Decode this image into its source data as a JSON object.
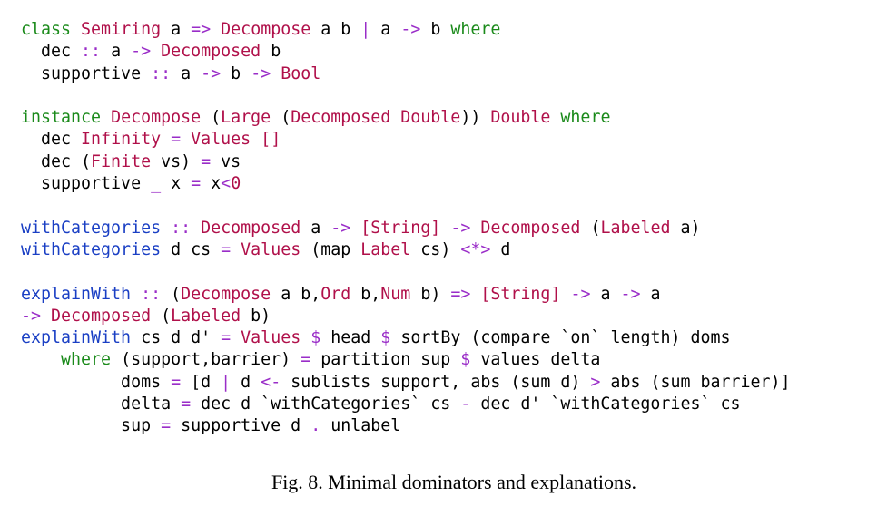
{
  "colors": {
    "keyword": "#1a8a1a",
    "type": "#b0104a",
    "function": "#1a3fc4",
    "operator": "#9a2dc8",
    "text": "#000000"
  },
  "code": [
    [
      [
        "kw",
        "class"
      ],
      [
        "tx",
        " "
      ],
      [
        "ty",
        "Semiring"
      ],
      [
        "tx",
        " a "
      ],
      [
        "op",
        "=>"
      ],
      [
        "tx",
        " "
      ],
      [
        "ty",
        "Decompose"
      ],
      [
        "tx",
        " a b "
      ],
      [
        "op",
        "|"
      ],
      [
        "tx",
        " a "
      ],
      [
        "op",
        "->"
      ],
      [
        "tx",
        " b "
      ],
      [
        "kw",
        "where"
      ]
    ],
    [
      [
        "tx",
        "  dec "
      ],
      [
        "op",
        "::"
      ],
      [
        "tx",
        " a "
      ],
      [
        "op",
        "->"
      ],
      [
        "tx",
        " "
      ],
      [
        "ty",
        "Decomposed"
      ],
      [
        "tx",
        " b"
      ]
    ],
    [
      [
        "tx",
        "  supportive "
      ],
      [
        "op",
        "::"
      ],
      [
        "tx",
        " a "
      ],
      [
        "op",
        "->"
      ],
      [
        "tx",
        " b "
      ],
      [
        "op",
        "->"
      ],
      [
        "tx",
        " "
      ],
      [
        "ty",
        "Bool"
      ]
    ],
    [],
    [
      [
        "kw",
        "instance"
      ],
      [
        "tx",
        " "
      ],
      [
        "ty",
        "Decompose"
      ],
      [
        "tx",
        " ("
      ],
      [
        "ty",
        "Large"
      ],
      [
        "tx",
        " ("
      ],
      [
        "ty",
        "Decomposed"
      ],
      [
        "tx",
        " "
      ],
      [
        "ty",
        "Double"
      ],
      [
        "tx",
        ")) "
      ],
      [
        "ty",
        "Double"
      ],
      [
        "tx",
        " "
      ],
      [
        "kw",
        "where"
      ]
    ],
    [
      [
        "tx",
        "  dec "
      ],
      [
        "ty",
        "Infinity"
      ],
      [
        "tx",
        " "
      ],
      [
        "op",
        "="
      ],
      [
        "tx",
        " "
      ],
      [
        "ty",
        "Values"
      ],
      [
        "tx",
        " "
      ],
      [
        "ty",
        "[]"
      ]
    ],
    [
      [
        "tx",
        "  dec ("
      ],
      [
        "ty",
        "Finite"
      ],
      [
        "tx",
        " vs) "
      ],
      [
        "op",
        "="
      ],
      [
        "tx",
        " vs"
      ]
    ],
    [
      [
        "tx",
        "  supportive "
      ],
      [
        "op",
        "_"
      ],
      [
        "tx",
        " x "
      ],
      [
        "op",
        "="
      ],
      [
        "tx",
        " x"
      ],
      [
        "op",
        "<"
      ],
      [
        "ty",
        "0"
      ]
    ],
    [],
    [
      [
        "fn",
        "withCategories"
      ],
      [
        "tx",
        " "
      ],
      [
        "op",
        "::"
      ],
      [
        "tx",
        " "
      ],
      [
        "ty",
        "Decomposed"
      ],
      [
        "tx",
        " a "
      ],
      [
        "op",
        "->"
      ],
      [
        "tx",
        " "
      ],
      [
        "ty",
        "[String]"
      ],
      [
        "tx",
        " "
      ],
      [
        "op",
        "->"
      ],
      [
        "tx",
        " "
      ],
      [
        "ty",
        "Decomposed"
      ],
      [
        "tx",
        " ("
      ],
      [
        "ty",
        "Labeled"
      ],
      [
        "tx",
        " a)"
      ]
    ],
    [
      [
        "fn",
        "withCategories"
      ],
      [
        "tx",
        " d cs "
      ],
      [
        "op",
        "="
      ],
      [
        "tx",
        " "
      ],
      [
        "ty",
        "Values"
      ],
      [
        "tx",
        " (map "
      ],
      [
        "ty",
        "Label"
      ],
      [
        "tx",
        " cs) "
      ],
      [
        "op",
        "<*>"
      ],
      [
        "tx",
        " d"
      ]
    ],
    [],
    [
      [
        "fn",
        "explainWith"
      ],
      [
        "tx",
        " "
      ],
      [
        "op",
        "::"
      ],
      [
        "tx",
        " ("
      ],
      [
        "ty",
        "Decompose"
      ],
      [
        "tx",
        " a b,"
      ],
      [
        "ty",
        "Ord"
      ],
      [
        "tx",
        " b,"
      ],
      [
        "ty",
        "Num"
      ],
      [
        "tx",
        " b) "
      ],
      [
        "op",
        "=>"
      ],
      [
        "tx",
        " "
      ],
      [
        "ty",
        "[String]"
      ],
      [
        "tx",
        " "
      ],
      [
        "op",
        "->"
      ],
      [
        "tx",
        " a "
      ],
      [
        "op",
        "->"
      ],
      [
        "tx",
        " a"
      ]
    ],
    [
      [
        "op",
        "->"
      ],
      [
        "tx",
        " "
      ],
      [
        "ty",
        "Decomposed"
      ],
      [
        "tx",
        " ("
      ],
      [
        "ty",
        "Labeled"
      ],
      [
        "tx",
        " b)"
      ]
    ],
    [
      [
        "fn",
        "explainWith"
      ],
      [
        "tx",
        " cs d d' "
      ],
      [
        "op",
        "="
      ],
      [
        "tx",
        " "
      ],
      [
        "ty",
        "Values"
      ],
      [
        "tx",
        " "
      ],
      [
        "op",
        "$"
      ],
      [
        "tx",
        " head "
      ],
      [
        "op",
        "$"
      ],
      [
        "tx",
        " sortBy (compare `on` length) doms"
      ]
    ],
    [
      [
        "tx",
        "    "
      ],
      [
        "kw",
        "where"
      ],
      [
        "tx",
        " (support,barrier) "
      ],
      [
        "op",
        "="
      ],
      [
        "tx",
        " partition sup "
      ],
      [
        "op",
        "$"
      ],
      [
        "tx",
        " values delta"
      ]
    ],
    [
      [
        "tx",
        "          doms "
      ],
      [
        "op",
        "="
      ],
      [
        "tx",
        " [d "
      ],
      [
        "op",
        "|"
      ],
      [
        "tx",
        " d "
      ],
      [
        "op",
        "<-"
      ],
      [
        "tx",
        " sublists support, abs (sum d) "
      ],
      [
        "op",
        ">"
      ],
      [
        "tx",
        " abs (sum barrier)]"
      ]
    ],
    [
      [
        "tx",
        "          delta "
      ],
      [
        "op",
        "="
      ],
      [
        "tx",
        " dec d `withCategories` cs "
      ],
      [
        "op",
        "-"
      ],
      [
        "tx",
        " dec d' `withCategories` cs"
      ]
    ],
    [
      [
        "tx",
        "          sup "
      ],
      [
        "op",
        "="
      ],
      [
        "tx",
        " supportive d "
      ],
      [
        "op",
        "."
      ],
      [
        "tx",
        " unlabel"
      ]
    ]
  ],
  "caption": "Fig. 8.  Minimal dominators and explanations."
}
